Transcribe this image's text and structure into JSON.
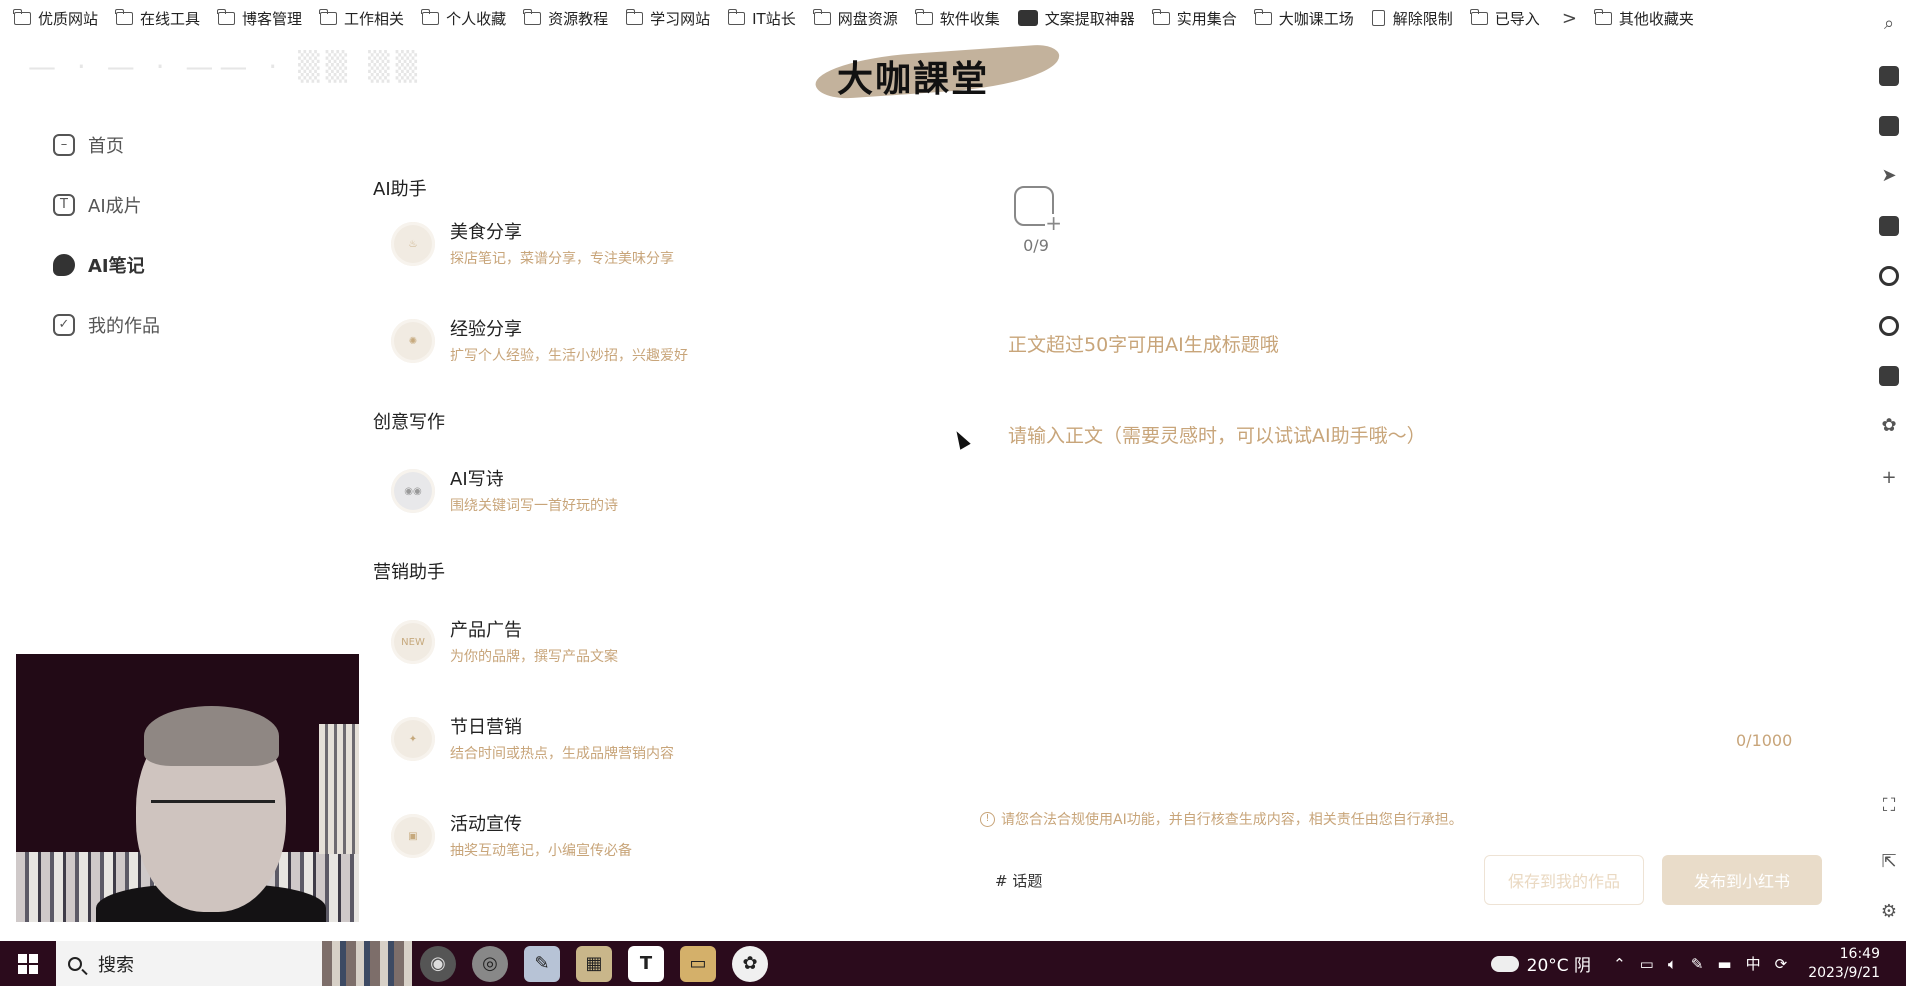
{
  "bookmarks": [
    {
      "label": "优质网站",
      "kind": "folder"
    },
    {
      "label": "在线工具",
      "kind": "folder"
    },
    {
      "label": "博客管理",
      "kind": "folder"
    },
    {
      "label": "工作相关",
      "kind": "folder"
    },
    {
      "label": "个人收藏",
      "kind": "folder"
    },
    {
      "label": "资源教程",
      "kind": "folder"
    },
    {
      "label": "学习网站",
      "kind": "folder"
    },
    {
      "label": "IT站长",
      "kind": "folder"
    },
    {
      "label": "网盘资源",
      "kind": "folder"
    },
    {
      "label": "软件收集",
      "kind": "folder"
    },
    {
      "label": "文案提取神器",
      "kind": "app"
    },
    {
      "label": "实用集合",
      "kind": "folder"
    },
    {
      "label": "大咖课工场",
      "kind": "folder"
    },
    {
      "label": "解除限制",
      "kind": "doc"
    },
    {
      "label": "已导入",
      "kind": "folder"
    }
  ],
  "bookmarks_more": ">",
  "bookmarks_other": "其他收藏夹",
  "logo_text": "大咖課堂",
  "nav": {
    "home": "首页",
    "ai_film": "AI成片",
    "ai_note": "AI笔记",
    "my_works": "我的作品"
  },
  "sections": {
    "assistant": "AI助手",
    "creative": "创意写作",
    "marketing": "营销助手"
  },
  "cards": {
    "food": {
      "title": "美食分享",
      "desc": "探店笔记，菜谱分享，专注美味分享"
    },
    "experience": {
      "title": "经验分享",
      "desc": "扩写个人经验，生活小妙招，兴趣爱好"
    },
    "poem": {
      "title": "AI写诗",
      "desc": "围绕关键词写一首好玩的诗"
    },
    "product_ad": {
      "title": "产品广告",
      "desc": "为你的品牌，撰写产品文案",
      "badge": "NEW"
    },
    "holiday": {
      "title": "节日营销",
      "desc": "结合时间或热点，生成品牌营销内容"
    },
    "event": {
      "title": "活动宣传",
      "desc": "抽奖互动笔记，小编宣传必备"
    }
  },
  "editor": {
    "image_count": "0/9",
    "title_placeholder": "正文超过50字可用AI生成标题哦",
    "body_placeholder": "请输入正文（需要灵感时，可以试试AI助手哦～）",
    "body_count": "0/1000",
    "notice": "请您合法合规使用AI功能，并自行核查生成内容，相关责任由您自行承担。",
    "topic": "# 话题",
    "save_button": "保存到我的作品",
    "publish_button": "发布到小红书"
  },
  "taskbar": {
    "search_label": "搜索",
    "weather": "20°C 阴",
    "ime": "中",
    "time": "16:49",
    "date": "2023/9/21"
  }
}
